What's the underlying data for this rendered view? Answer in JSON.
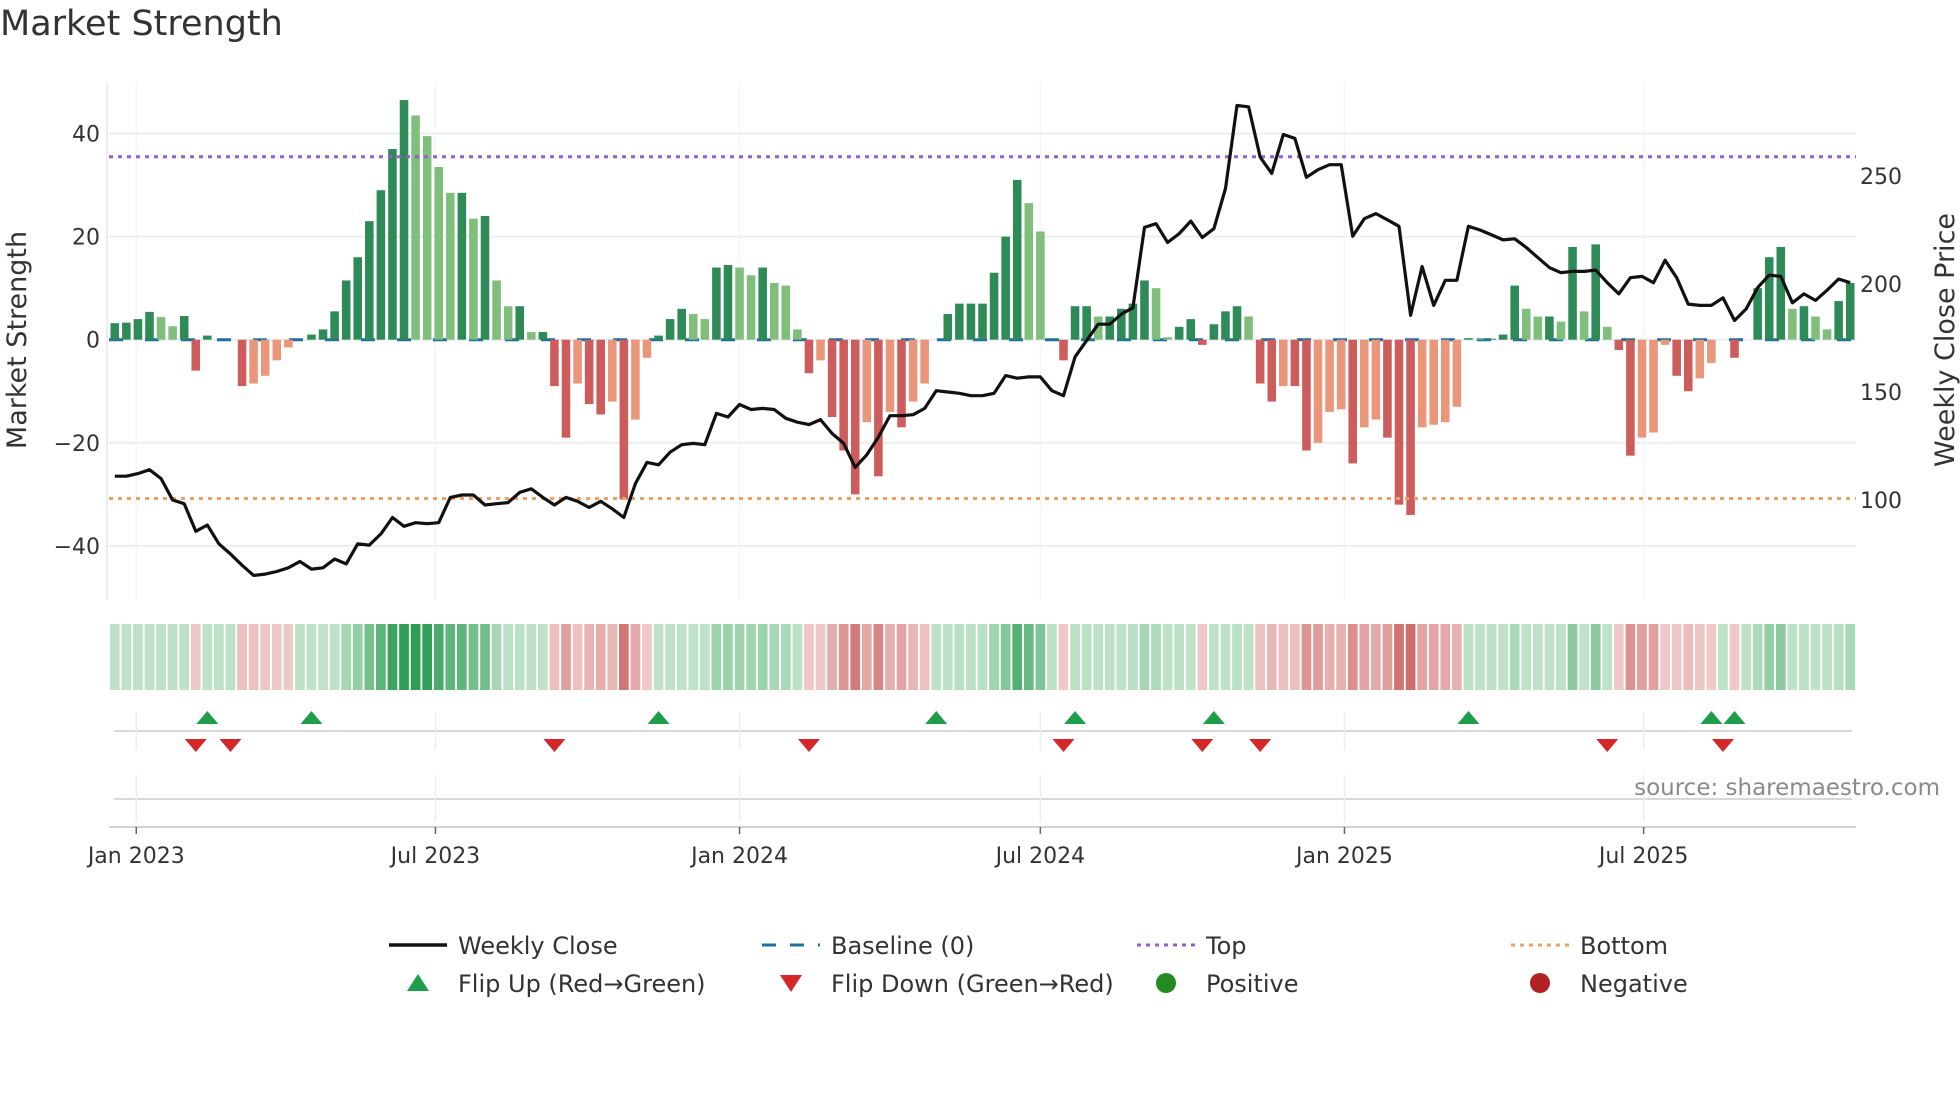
{
  "chart_data": {
    "type": "bar",
    "title": "Market Strength",
    "ylabel": "Market Strength",
    "y2label": "Weekly Close Price",
    "ylim": [
      -50.5,
      50
    ],
    "y2lim": [
      53.7,
      293.5
    ],
    "yticks": [
      40,
      20,
      0,
      -20,
      -40
    ],
    "y2ticks": [
      250,
      200,
      150,
      100
    ],
    "start_week": "2022-12-19",
    "xticks": [
      {
        "date": "2023-01-01",
        "label": "Jan 2023"
      },
      {
        "date": "2023-07-01",
        "label": "Jul 2023"
      },
      {
        "date": "2024-01-01",
        "label": "Jan 2024"
      },
      {
        "date": "2024-07-01",
        "label": "Jul 2024"
      },
      {
        "date": "2025-01-01",
        "label": "Jan 2025"
      },
      {
        "date": "2025-07-01",
        "label": "Jul 2025"
      }
    ],
    "top_level": 35.5,
    "bottom_level": -30.8,
    "strength": [
      3.2,
      3.3,
      4,
      5.4,
      4.4,
      2.6,
      4.6,
      -6,
      0.8,
      0,
      0,
      -9,
      -8.5,
      -7,
      -4,
      -1.5,
      0,
      1,
      2,
      5.5,
      11.5,
      16,
      23,
      29,
      37,
      46.5,
      43.5,
      39.5,
      33.5,
      28.5,
      28.5,
      23.5,
      24,
      11.5,
      6.5,
      6.5,
      1.5,
      1.5,
      -9,
      -19,
      -8.5,
      -12.5,
      -14.5,
      -12,
      -31,
      -15.5,
      -3.5,
      0.8,
      4,
      6,
      5,
      4,
      14,
      14.5,
      14,
      12.5,
      14,
      11,
      10.5,
      2,
      -6.5,
      -4,
      -15,
      -21.5,
      -30,
      -16,
      -26.5,
      -14,
      -17,
      -12,
      -8.5,
      0,
      5,
      7,
      7,
      7,
      13,
      20,
      31,
      26.5,
      21,
      0,
      -4,
      6.5,
      6.5,
      4.5,
      4.5,
      6,
      7,
      11.5,
      10,
      0.5,
      2.5,
      4,
      -1,
      3,
      5.5,
      6.5,
      4.5,
      -8.5,
      -12,
      -9,
      -9,
      -21.5,
      -20,
      -14,
      -13.5,
      -24,
      -17,
      -15.5,
      -19,
      -32,
      -34,
      -17,
      -16.5,
      -16,
      -13,
      0.3,
      0.2,
      0.2,
      1,
      10.5,
      6,
      4.5,
      4.5,
      3.5,
      18,
      5.5,
      18.5,
      2.5,
      -2,
      -22.5,
      -19,
      -18,
      -1,
      -7,
      -10,
      -7.5,
      -4.5,
      0,
      -3.5,
      0,
      10,
      16,
      18,
      6,
      6.5,
      4.5,
      2,
      7.5,
      11
    ],
    "weekly_close": [
      111,
      111,
      112.2,
      114,
      109.9,
      100,
      98.3,
      85.5,
      88.4,
      79.7,
      75,
      69.8,
      65.1,
      65.7,
      66.9,
      68.6,
      71.5,
      68,
      68.6,
      72.7,
      70.4,
      79.7,
      79.1,
      84.3,
      91.9,
      87.8,
      89.5,
      89,
      89.5,
      101.2,
      102.3,
      102.3,
      97.7,
      98.3,
      98.8,
      103.5,
      105.2,
      101.2,
      97.7,
      101.2,
      99.4,
      96.5,
      99.4,
      95.9,
      91.9,
      107.6,
      117.4,
      116.3,
      122.1,
      125.6,
      126.2,
      125.6,
      140.1,
      138.4,
      144.2,
      141.9,
      142.4,
      141.9,
      137.8,
      136,
      134.9,
      137.2,
      130.8,
      126.2,
      115.1,
      120.9,
      129.1,
      139,
      139,
      139.5,
      142.4,
      150.6,
      150,
      149.4,
      148.3,
      148.3,
      149.4,
      157.6,
      156.4,
      157,
      157,
      150.6,
      148.3,
      166.3,
      173.8,
      181.4,
      181.4,
      186,
      189,
      226.2,
      227.9,
      219.2,
      223.3,
      229.1,
      221.5,
      225.6,
      244.2,
      282.6,
      282,
      258.7,
      251.2,
      269.2,
      267.4,
      249.4,
      252.9,
      255.2,
      255.2,
      222.1,
      230.2,
      232.6,
      229.7,
      226.7,
      185.5,
      208.1,
      190.1,
      201.7,
      201.7,
      226.7,
      225,
      222.7,
      220.4,
      220.9,
      216.9,
      212.2,
      207.6,
      205.2,
      205.8,
      205.8,
      206.4,
      200.6,
      195.4,
      202.9,
      203.5,
      200.6,
      211,
      202.9,
      190.7,
      190.1,
      190.1,
      193.6,
      183.1,
      188.4,
      198.3,
      204.1,
      203.5,
      191.3,
      195.4,
      192.4,
      197.1,
      202.3,
      200.6
    ],
    "flip_up_weeks": [
      8,
      17,
      47,
      71,
      83,
      95,
      117,
      138,
      140
    ],
    "flip_down_weeks": [
      7,
      10,
      38,
      60,
      82,
      94,
      99,
      129,
      139
    ],
    "legend": {
      "placement": "bottom",
      "entries": [
        {
          "label": "Weekly Close",
          "kind": "line"
        },
        {
          "label": "Baseline (0)",
          "kind": "dash"
        },
        {
          "label": "Top",
          "kind": "dot-top"
        },
        {
          "label": "Bottom",
          "kind": "dot-bottom"
        },
        {
          "label": "Flip Up (Red→Green)",
          "kind": "tri-up"
        },
        {
          "label": "Flip Down (Green→Red)",
          "kind": "tri-down"
        },
        {
          "label": "Positive",
          "kind": "dot-pos"
        },
        {
          "label": "Negative",
          "kind": "dot-neg"
        }
      ]
    },
    "source": "source: sharemaestro.com",
    "colors": {
      "pos_dark": "#2e8b57",
      "pos_light": "#7fbf7b",
      "neg_dark": "#cd5c5c",
      "neg_light": "#e9967a",
      "line": "#111111",
      "baseline": "#1f6f9f",
      "top": "#9b59d6",
      "bottom": "#f0a060",
      "flip_up": "#1e9e4a",
      "flip_down": "#d62728",
      "positive": "#228b22",
      "negative": "#b22222"
    }
  }
}
